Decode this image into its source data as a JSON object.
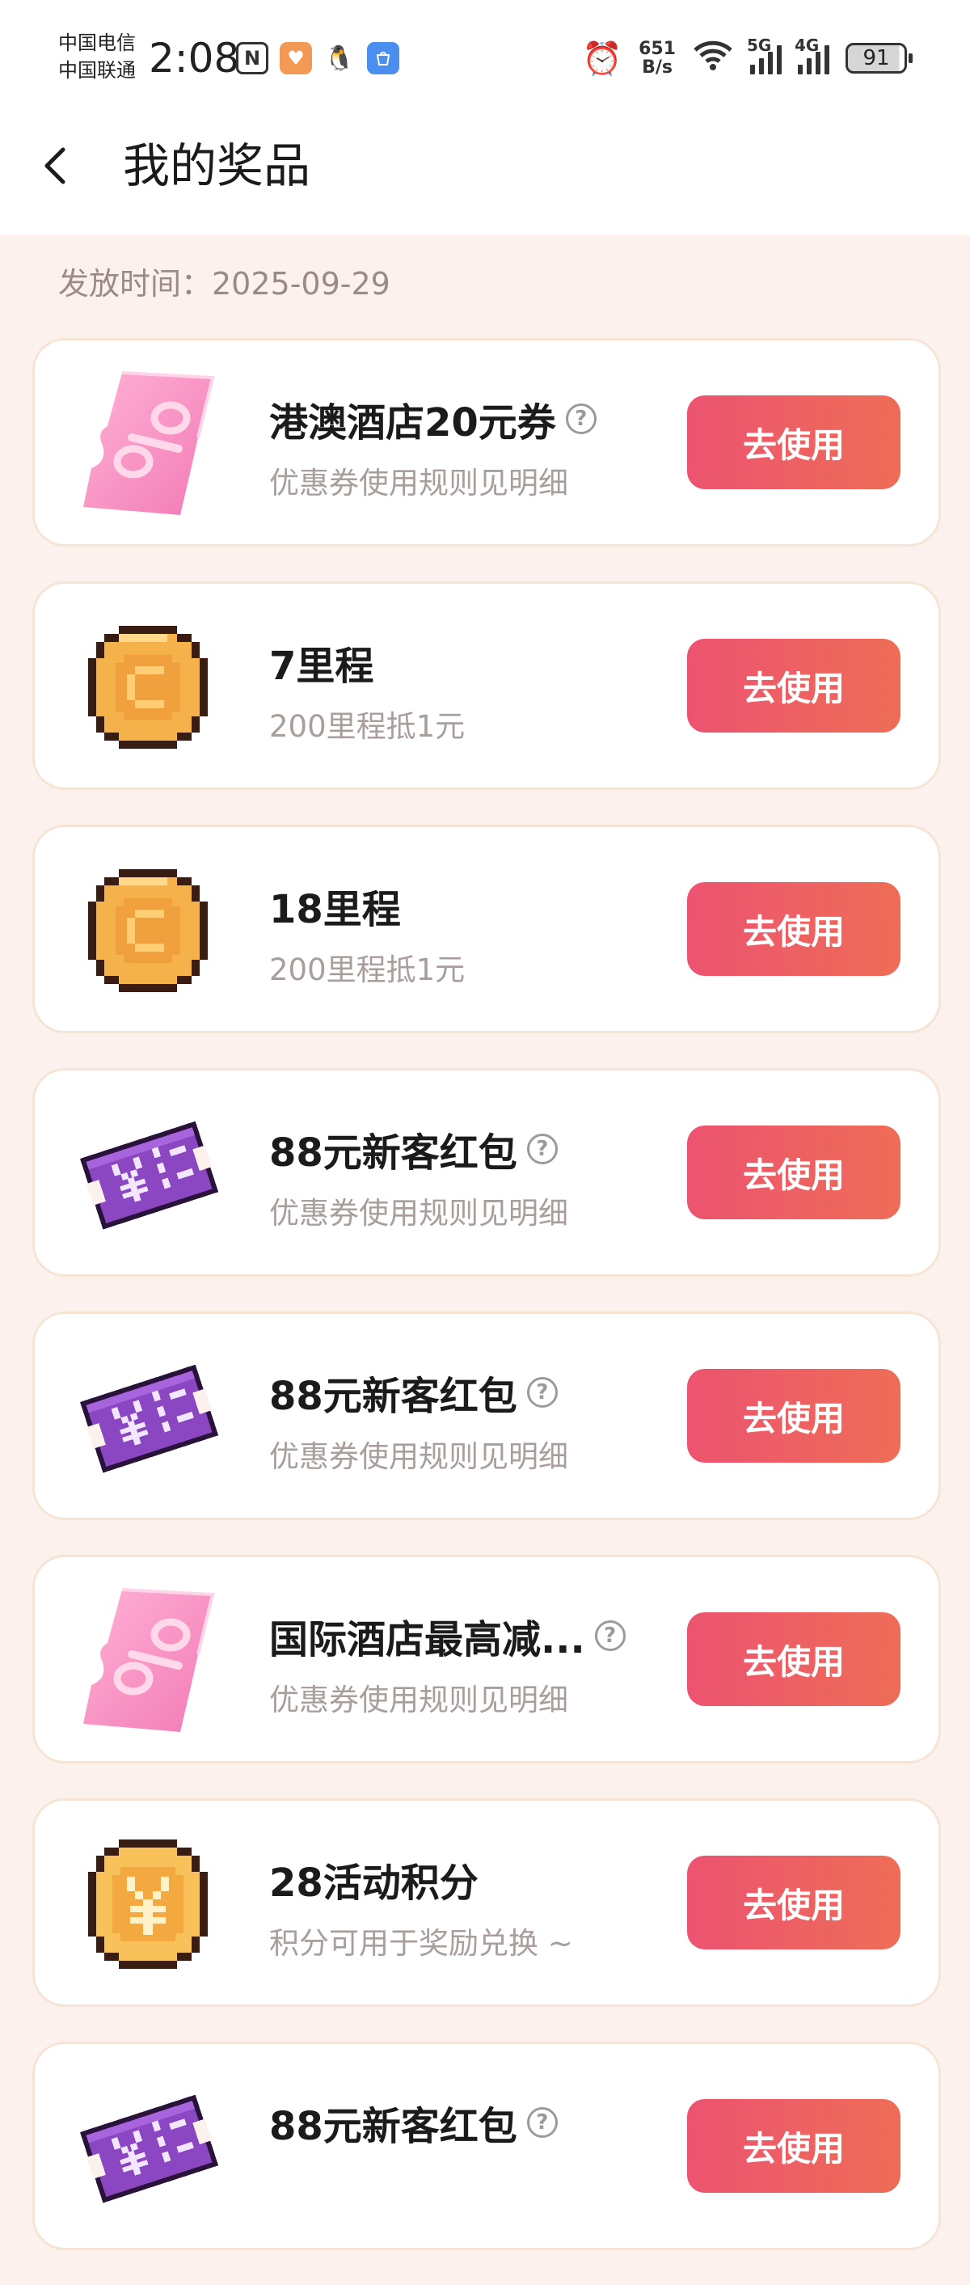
{
  "status_bar": {
    "carrier_1": "中国电信",
    "carrier_2": "中国联通",
    "time": "2:08",
    "net_speed_value": "651",
    "net_speed_unit": "B/s",
    "sim1_gen": "5G",
    "sim2_gen": "4G",
    "battery": "91",
    "icons": [
      "nfc-icon",
      "app-icon",
      "qq-icon",
      "app-store-icon",
      "alarm-icon",
      "wifi-icon",
      "signal-icon",
      "battery-icon"
    ]
  },
  "header": {
    "title": "我的奖品"
  },
  "issue_date": "发放时间：2025-09-29",
  "accent_colors": {
    "button_start": "#ec5370",
    "button_end": "#ee6d56",
    "background": "#fcf1ec"
  },
  "prizes": [
    {
      "title": "港澳酒店20元券",
      "subtitle": "优惠券使用规则见明细",
      "has_help": true,
      "art": "pink-discount-coupon-icon",
      "button": "去使用"
    },
    {
      "title": "7里程",
      "subtitle": "200里程抵1元",
      "has_help": false,
      "art": "mileage-coin-icon",
      "button": "去使用"
    },
    {
      "title": "18里程",
      "subtitle": "200里程抵1元",
      "has_help": false,
      "art": "mileage-coin-icon",
      "button": "去使用"
    },
    {
      "title": "88元新客红包",
      "subtitle": "优惠券使用规则见明细",
      "has_help": true,
      "art": "purple-yen-ticket-icon",
      "button": "去使用"
    },
    {
      "title": "88元新客红包",
      "subtitle": "优惠券使用规则见明细",
      "has_help": true,
      "art": "purple-yen-ticket-icon",
      "button": "去使用"
    },
    {
      "title": "国际酒店最高减...",
      "subtitle": "优惠券使用规则见明细",
      "has_help": true,
      "art": "pink-discount-coupon-icon",
      "button": "去使用"
    },
    {
      "title": "28活动积分",
      "subtitle": "积分可用于奖励兑换 ~",
      "has_help": false,
      "art": "yen-coin-icon",
      "button": "去使用"
    },
    {
      "title": "88元新客红包",
      "subtitle": "",
      "has_help": true,
      "art": "purple-yen-ticket-icon",
      "button": "去使用"
    }
  ]
}
